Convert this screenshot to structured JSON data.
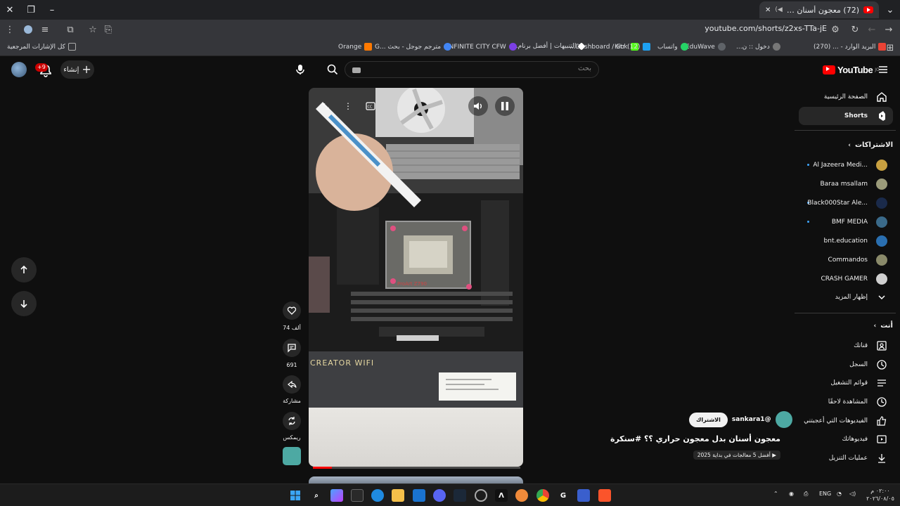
{
  "browser": {
    "tab_title": "(72) معجون أسنان بدل معج...",
    "new_tab": "+",
    "url": "youtube.com/shorts/z2xs-TTa-jE",
    "bookmarks_all": "كل الإشارات المرجعية",
    "bookmarks": [
      {
        "label": "البريد الوارد - ... (270)",
        "color": "#ea4335"
      },
      {
        "label": "دخول :: ن...",
        "color": "#777777"
      },
      {
        "label": "EduWave",
        "color": "#5f6368"
      },
      {
        "label": "واتساب",
        "color": "#25d366"
      },
      {
        "label": "Kick",
        "color": "#53fc18"
      },
      {
        "label": "(12) Dashboard / Str...",
        "color": "#1da1f2"
      },
      {
        "label": "التنبيهات | أفضل برنام...",
        "color": "#ffffff"
      },
      {
        "label": "INFINITE CITY CFW",
        "color": "#7b3fe4"
      },
      {
        "label": "مترجم جوجل - بحث ...G",
        "color": "#4285f4"
      },
      {
        "label": "Orange",
        "color": "#ff7900"
      }
    ]
  },
  "youtube": {
    "logo": "YouTube",
    "logo_region": "JO",
    "search_placeholder": "بحث",
    "create_label": "إنشاء",
    "notif_badge": "+9",
    "sidebar": {
      "home": "الصفحة الرئيسية",
      "shorts": "Shorts",
      "subscriptions": "الاشتراكات",
      "channels": [
        {
          "name": "Al Jazeera Medi...",
          "color": "#c8a040",
          "dot": true
        },
        {
          "name": "Baraa msallam",
          "color": "#9b9b7a",
          "dot": false
        },
        {
          "name": "Black000Star Ale...",
          "color": "#1a2a4a",
          "dot": true
        },
        {
          "name": "BMF MEDIA",
          "color": "#3a6a8a",
          "dot": true
        },
        {
          "name": "bnt.education",
          "color": "#2a6fb0",
          "dot": false
        },
        {
          "name": "Commandos",
          "color": "#8a8a6a",
          "dot": false
        },
        {
          "name": "CRASH GAMER",
          "color": "#d0d0d0",
          "dot": false
        }
      ],
      "show_more": "إظهار المزيد",
      "you": "أنت",
      "you_items": [
        {
          "label": "قناتك",
          "icon": "channel-icon"
        },
        {
          "label": "السجل",
          "icon": "history-icon"
        },
        {
          "label": "قوائم التشغيل",
          "icon": "playlists-icon"
        },
        {
          "label": "المشاهدة لاحقًا",
          "icon": "watch-later-icon"
        },
        {
          "label": "الفيديوهات التي أعجبتني",
          "icon": "like-icon"
        },
        {
          "label": "فيديوهاتك",
          "icon": "your-videos-icon"
        },
        {
          "label": "عمليات التنزيل",
          "icon": "download-icon"
        }
      ]
    },
    "short": {
      "likes": "74 ألف",
      "comments": "691",
      "share": "مشاركة",
      "remix": "ريمكس",
      "channel": "@sankara1",
      "subscribe": "الاشتراك",
      "title": "معجون أسنان بدل معجون حراري ؟؟ #سنكرة",
      "playlist": "أفضل 5 معالجات في بداية 2025",
      "progress": 0.09,
      "video_text": "CREATOR WIFI",
      "board_text": "ProArt Z790"
    }
  },
  "taskbar": {
    "lang": "ENG",
    "time": "٠٢:٠٠ م",
    "date": "٢٠٢٦/٠٨/٠٥"
  },
  "colors": {
    "accent_red": "#ff0000",
    "bg": "#0f0f0f",
    "surface": "#272727"
  }
}
